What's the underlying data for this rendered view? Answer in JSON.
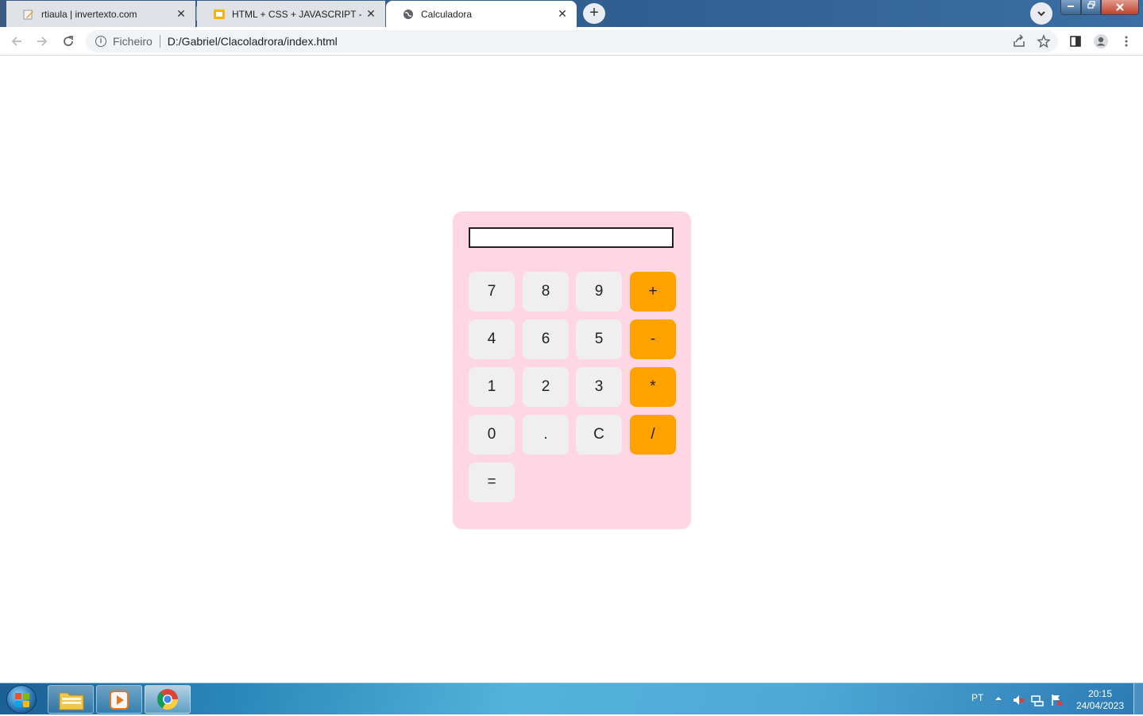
{
  "browser": {
    "tabs": [
      {
        "title": "rtiaula | invertexto.com",
        "favicon": "pencil-note-icon"
      },
      {
        "title": "HTML + CSS + JAVASCRIPT - Goo",
        "favicon": "slides-icon"
      },
      {
        "title": "Calculadora",
        "favicon": "globe-icon"
      }
    ],
    "close_glyph": "✕",
    "new_tab_glyph": "+",
    "address": {
      "chip": "Ficheiro",
      "url": "D:/Gabriel/Clacoladrora/index.html"
    }
  },
  "calculator": {
    "display_value": "",
    "keys": {
      "row1": [
        "7",
        "8",
        "9",
        "+"
      ],
      "row2": [
        "4",
        "6",
        "5",
        "-"
      ],
      "row3": [
        "1",
        "2",
        "3",
        "*"
      ],
      "row4": [
        "0",
        ".",
        "C",
        "/"
      ],
      "row5": [
        "="
      ]
    },
    "colors": {
      "panel": "#ffd6e3",
      "key": "#efefef",
      "operator": "#ffa200"
    }
  },
  "taskbar": {
    "language": "PT",
    "time": "20:15",
    "date": "24/04/2023"
  }
}
